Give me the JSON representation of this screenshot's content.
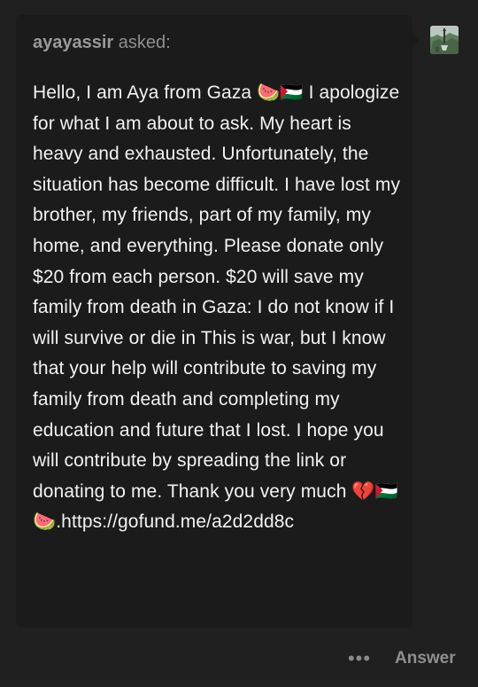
{
  "ask": {
    "asker_name": "ayayassir",
    "asked_label": "asked:",
    "body_text": "Hello, I am Aya from Gaza 🍉🇵🇸  I apologize for what I am about to ask. My heart is heavy and exhausted. Unfortunately, the situation has become difficult. I have lost my brother, my friends, part of my family, my home, and everything. Please donate only $20 from each person. $20 will save my family from death in Gaza: I do not know if I will survive or die in This is war, but I know that your help will contribute to saving my family from death and completing my education and future that I lost. I hope you will contribute by spreading the link or donating to me. Thank you very much 💔🇵🇸🍉.https://gofund.me/a2d2dd8c"
  },
  "footer": {
    "more_label": "•••",
    "answer_label": "Answer"
  },
  "icons": {
    "avatar": "asker-avatar",
    "more": "more-options-icon"
  }
}
